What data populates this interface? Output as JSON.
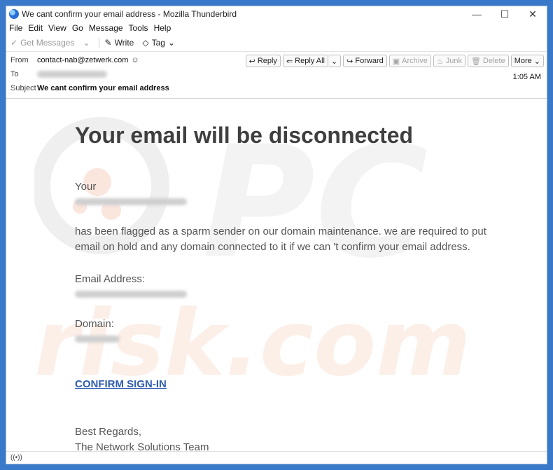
{
  "window": {
    "title": "We cant confirm your email address - Mozilla Thunderbird",
    "minimize": "—",
    "maximize": "☐",
    "close": "✕"
  },
  "menu": {
    "items": [
      "File",
      "Edit",
      "View",
      "Go",
      "Message",
      "Tools",
      "Help"
    ]
  },
  "toolbar": {
    "get_messages": "Get Messages",
    "write": "Write",
    "tag": "Tag"
  },
  "header": {
    "from_label": "From",
    "from_value": "contact-nab@zetwerk.com",
    "to_label": "To",
    "subject_label": "Subject",
    "subject_value": "We cant confirm your email address",
    "time": "1:05 AM",
    "buttons": {
      "reply": "Reply",
      "reply_all": "Reply All",
      "forward": "Forward",
      "archive": "Archive",
      "junk": "Junk",
      "delete": "Delete",
      "more": "More"
    }
  },
  "email": {
    "headline": "Your email will be disconnected",
    "your": "Your",
    "body_line1": " has been flagged as a sparm sender on our domain maintenance. we are required to put",
    "body_line2": "email on hold and any domain connected to it if we can  't confirm your email address.",
    "email_address_label": "Email Address:",
    "domain_label": "Domain:",
    "confirm_link": "CONFIRM SIGN-IN",
    "regards": "Best Regards,",
    "team": "The Network Solutions Team"
  },
  "watermark": {
    "text": "risk.com",
    "letters": "PC"
  },
  "colors": {
    "accent": "#3a78c9",
    "link": "#2f5cb3"
  }
}
